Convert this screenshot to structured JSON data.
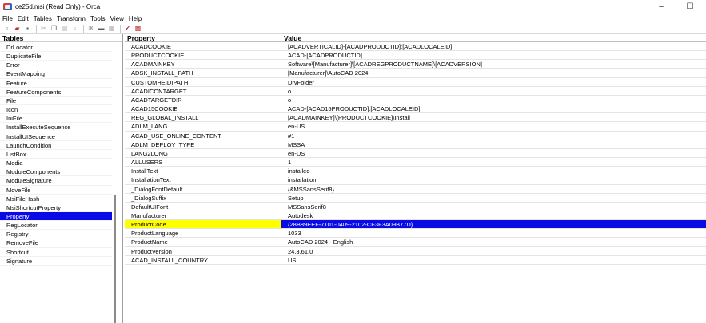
{
  "window": {
    "title": "ce25d.msi (Read Only) - Orca",
    "minimize": "–",
    "maximize": "☐"
  },
  "menu": [
    "File",
    "Edit",
    "Tables",
    "Transform",
    "Tools",
    "View",
    "Help"
  ],
  "toolbar": [
    {
      "name": "new-icon",
      "glyph": "▫",
      "state": "normal"
    },
    {
      "name": "open-icon",
      "glyph": "▰",
      "state": "colored"
    },
    {
      "name": "save-icon",
      "glyph": "▪",
      "state": "normal"
    },
    {
      "name": "cut-icon",
      "glyph": "✂",
      "state": "dim"
    },
    {
      "name": "copy-icon",
      "glyph": "❐",
      "state": "normal"
    },
    {
      "name": "paste-icon",
      "glyph": "▤",
      "state": "dim"
    },
    {
      "name": "find-icon",
      "glyph": "⌕",
      "state": "dim"
    },
    {
      "name": "add-table-icon",
      "glyph": "✱",
      "state": "dim"
    },
    {
      "name": "add-row-icon",
      "glyph": "▬",
      "state": "normal"
    },
    {
      "name": "drop-icon",
      "glyph": "▦",
      "state": "dim"
    },
    {
      "name": "validate-icon",
      "glyph": "✔",
      "state": "colored"
    },
    {
      "name": "merge-icon",
      "glyph": "▩",
      "state": "colored"
    }
  ],
  "tables_pane": {
    "header": "Tables",
    "items": [
      {
        "label": "DrLocator",
        "selected": false
      },
      {
        "label": "DuplicateFile",
        "selected": false
      },
      {
        "label": "Error",
        "selected": false
      },
      {
        "label": "EventMapping",
        "selected": false
      },
      {
        "label": "Feature",
        "selected": false
      },
      {
        "label": "FeatureComponents",
        "selected": false
      },
      {
        "label": "File",
        "selected": false
      },
      {
        "label": "Icon",
        "selected": false
      },
      {
        "label": "IniFile",
        "selected": false
      },
      {
        "label": "InstallExecuteSequence",
        "selected": false
      },
      {
        "label": "InstallUISequence",
        "selected": false
      },
      {
        "label": "LaunchCondition",
        "selected": false
      },
      {
        "label": "ListBox",
        "selected": false
      },
      {
        "label": "Media",
        "selected": false
      },
      {
        "label": "ModuleComponents",
        "selected": false
      },
      {
        "label": "ModuleSignature",
        "selected": false
      },
      {
        "label": "MoveFile",
        "selected": false
      },
      {
        "label": "MsiFileHash",
        "selected": false
      },
      {
        "label": "MsiShortcutProperty",
        "selected": false
      },
      {
        "label": "Property",
        "selected": true
      },
      {
        "label": "RegLocator",
        "selected": false
      },
      {
        "label": "Registry",
        "selected": false
      },
      {
        "label": "RemoveFile",
        "selected": false
      },
      {
        "label": "Shortcut",
        "selected": false
      },
      {
        "label": "Signature",
        "selected": false
      }
    ]
  },
  "grid": {
    "columns": [
      "Property",
      "Value"
    ],
    "rows": [
      {
        "property": "ACADCOOKIE",
        "value": "[ACADVERTICALID]-[ACADPRODUCTID]:[ACADLOCALEID]",
        "selected": false
      },
      {
        "property": "PRODUCTCOOKIE",
        "value": "ACAD-[ACADPRODUCTID]",
        "selected": false
      },
      {
        "property": "ACADMAINKEY",
        "value": "Software\\[Manufacturer]\\[ACADREGPRODUCTNAME]\\[ACADVERSION]",
        "selected": false
      },
      {
        "property": "ADSK_INSTALL_PATH",
        "value": "[Manufacturer]\\AutoCAD 2024",
        "selected": false
      },
      {
        "property": "CUSTOMHEIDIPATH",
        "value": "DrvFolder",
        "selected": false
      },
      {
        "property": "ACADICONTARGET",
        "value": "o",
        "selected": false
      },
      {
        "property": "ACADTARGETDIR",
        "value": "o",
        "selected": false
      },
      {
        "property": "ACAD15COOKIE",
        "value": "ACAD-[ACAD15PRODUCTID]:[ACADLOCALEID]",
        "selected": false
      },
      {
        "property": "REG_GLOBAL_INSTALL",
        "value": "[ACADMAINKEY]\\[PRODUCTCOOKIE]\\Install",
        "selected": false
      },
      {
        "property": "ADLM_LANG",
        "value": "en-US",
        "selected": false
      },
      {
        "property": "ACAD_USE_ONLINE_CONTENT",
        "value": "#1",
        "selected": false
      },
      {
        "property": "ADLM_DEPLOY_TYPE",
        "value": "MSSA",
        "selected": false
      },
      {
        "property": "LANG2LONG",
        "value": "en-US",
        "selected": false
      },
      {
        "property": "ALLUSERS",
        "value": "1",
        "selected": false
      },
      {
        "property": "InstallText",
        "value": "installed",
        "selected": false
      },
      {
        "property": "InstallationText",
        "value": "installation",
        "selected": false
      },
      {
        "property": "_DialogFontDefault",
        "value": "{&MSSansSerif8}",
        "selected": false
      },
      {
        "property": "_DialogSuffix",
        "value": "Setup",
        "selected": false
      },
      {
        "property": "DefaultUIFont",
        "value": "MSSansSerif8",
        "selected": false
      },
      {
        "property": "Manufacturer",
        "value": "Autodesk",
        "selected": false
      },
      {
        "property": "ProductCode",
        "value": "{28B89EEF-7101-0409-2102-CF3F3A09B77D}",
        "selected": true
      },
      {
        "property": "ProductLanguage",
        "value": "1033",
        "selected": false
      },
      {
        "property": "ProductName",
        "value": "AutoCAD 2024 - English",
        "selected": false
      },
      {
        "property": "ProductVersion",
        "value": "24.3.61.0",
        "selected": false
      },
      {
        "property": "ACAD_INSTALL_COUNTRY",
        "value": "US",
        "selected": false
      }
    ]
  },
  "colors": {
    "selection": "#0a0ae6",
    "selected_property_bg": "#ffff00"
  }
}
